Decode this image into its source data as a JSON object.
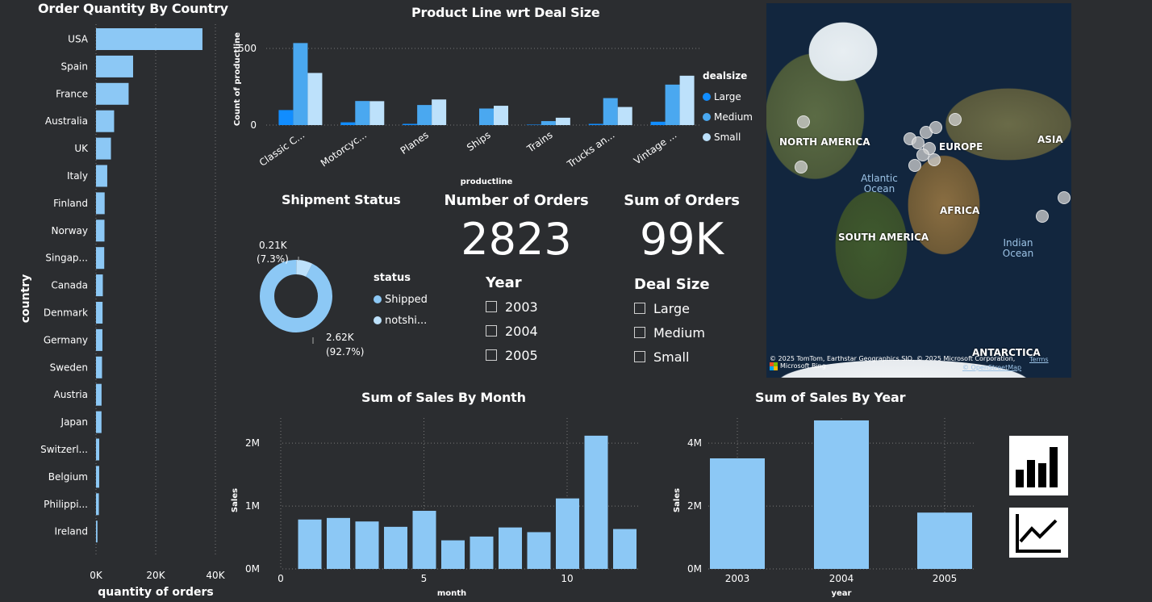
{
  "colors": {
    "bar": "#8cc8f5",
    "large": "#118dff",
    "medium": "#4aa8f0",
    "small": "#bde1fb",
    "bg": "#2b2d30"
  },
  "country_chart": {
    "title": "Order Quantity By Country",
    "ylabel": "country",
    "xlabel": "quantity of orders",
    "ticks": [
      "0K",
      "20K",
      "40K"
    ],
    "categories": [
      "USA",
      "Spain",
      "France",
      "Australia",
      "UK",
      "Italy",
      "Finland",
      "Norway",
      "Singap...",
      "Canada",
      "Denmark",
      "Germany",
      "Sweden",
      "Austria",
      "Japan",
      "Switzerl...",
      "Belgium",
      "Philippi...",
      "Ireland"
    ],
    "values": [
      35660,
      12430,
      10930,
      6070,
      5010,
      3770,
      2900,
      2840,
      2760,
      2290,
      2200,
      2150,
      2020,
      1860,
      1840,
      1080,
      1070,
      960,
      490
    ],
    "xlim": [
      0,
      40000
    ]
  },
  "product_chart": {
    "title": "Product Line wrt Deal Size",
    "ylabel": "Count of productline",
    "xlabel": "productline",
    "yticks": [
      "0",
      "500"
    ],
    "categories": [
      "Classic C...",
      "Motorcyc...",
      "Planes",
      "Ships",
      "Trains",
      "Trucks an...",
      "Vintage ..."
    ],
    "series": [
      {
        "name": "Large",
        "values": [
          98,
          18,
          8,
          0,
          3,
          8,
          22
        ]
      },
      {
        "name": "Medium",
        "values": [
          535,
          157,
          131,
          108,
          26,
          176,
          264
        ]
      },
      {
        "name": "Small",
        "values": [
          340,
          156,
          167,
          126,
          48,
          118,
          322
        ]
      }
    ],
    "legend_title": "dealsize",
    "ylim": [
      0,
      600
    ]
  },
  "shipment": {
    "title": "Shipment Status",
    "legend_title": "status",
    "legend": [
      "Shipped",
      "notshi..."
    ],
    "slices": [
      {
        "name": "Shipped",
        "value": 2617
      },
      {
        "name": "notshipped",
        "value": 206
      }
    ],
    "label_big": "2.62K",
    "label_big_pct": "(92.7%)",
    "label_small": "0.21K",
    "label_small_pct": "(7.3%)"
  },
  "orders_card": {
    "title": "Number of Orders",
    "value": "2823"
  },
  "sum_card": {
    "title": "Sum of Orders",
    "value": "99K"
  },
  "year_slicer": {
    "title": "Year",
    "items": [
      "2003",
      "2004",
      "2005"
    ]
  },
  "deal_slicer": {
    "title": "Deal Size",
    "items": [
      "Large",
      "Medium",
      "Small"
    ]
  },
  "map": {
    "labels": [
      "NORTH AMERICA",
      "EUROPE",
      "ASIA",
      "AFRICA",
      "SOUTH AMERICA",
      "ANTARCTICA"
    ],
    "oceans": [
      "Atlantic Ocean",
      "Indian Ocean"
    ],
    "attribution": "© 2025 TomTom, Earthstar Geographics SIO, © 2025 Microsoft Corporation,",
    "terms": "Terms",
    "osm": "© OpenStreetMap",
    "bing": "Microsoft Bing"
  },
  "month_chart": {
    "title": "Sum of Sales By Month",
    "ylabel": "Sales",
    "xlabel": "month",
    "yticks": [
      "0M",
      "1M",
      "2M"
    ],
    "xticks": [
      "0",
      "5",
      "10"
    ],
    "months": [
      1,
      2,
      3,
      4,
      5,
      6,
      7,
      8,
      9,
      10,
      11,
      12
    ],
    "values": [
      785874,
      810442,
      754501,
      669391,
      923973,
      454756,
      514876,
      659311,
      584724,
      1121215,
      2118886,
      634679
    ],
    "ylim": [
      0,
      2400000
    ]
  },
  "year_chart": {
    "title": "Sum of Sales By Year",
    "ylabel": "Sales",
    "xlabel": "year",
    "yticks": [
      "0M",
      "2M",
      "4M"
    ],
    "categories": [
      "2003",
      "2004",
      "2005"
    ],
    "values": [
      3516980,
      4724163,
      1791487
    ],
    "ylim": [
      0,
      4800000
    ]
  },
  "icons": [
    "bar-chart-icon",
    "line-chart-icon"
  ]
}
